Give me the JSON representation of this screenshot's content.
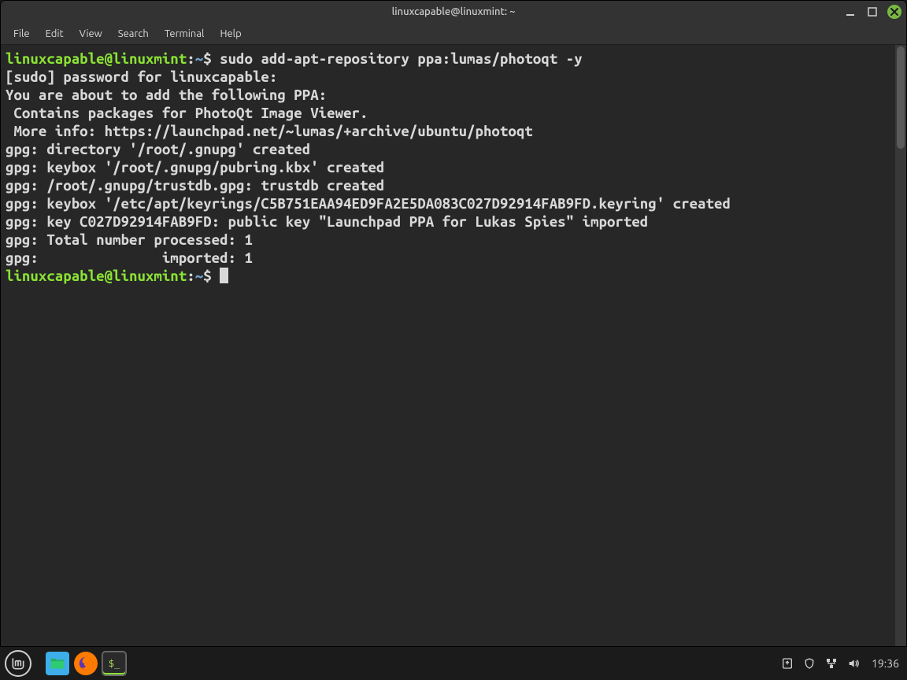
{
  "window": {
    "title": "linuxcapable@linuxmint: ~"
  },
  "menubar": {
    "items": [
      "File",
      "Edit",
      "View",
      "Search",
      "Terminal",
      "Help"
    ]
  },
  "terminal": {
    "prompt": {
      "user_host": "linuxcapable@linuxmint",
      "sep": ":",
      "path": "~",
      "end": "$ "
    },
    "command": "sudo add-apt-repository ppa:lumas/photoqt -y",
    "lines": [
      "[sudo] password for linuxcapable:",
      "You are about to add the following PPA:",
      " Contains packages for PhotoQt Image Viewer.",
      " More info: https://launchpad.net/~lumas/+archive/ubuntu/photoqt",
      "gpg: directory '/root/.gnupg' created",
      "gpg: keybox '/root/.gnupg/pubring.kbx' created",
      "gpg: /root/.gnupg/trustdb.gpg: trustdb created",
      "gpg: keybox '/etc/apt/keyrings/C5B751EAA94ED9FA2E5DA083C027D92914FAB9FD.keyring' created",
      "gpg: key C027D92914FAB9FD: public key \"Launchpad PPA for Lukas Spies\" imported",
      "gpg: Total number processed: 1",
      "gpg:               imported: 1"
    ]
  },
  "panel": {
    "clock": "19:36"
  }
}
